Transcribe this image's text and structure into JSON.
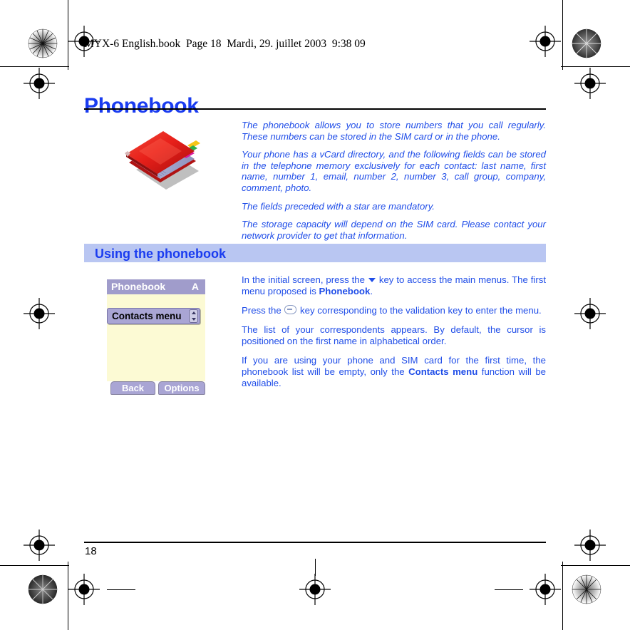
{
  "document": {
    "file_header": "MYX-6 English.book  Page 18  Mardi, 29. juillet 2003  9:38 09",
    "title": "Phonebook",
    "page_number": "18"
  },
  "colors": {
    "heading_blue": "#1a3cf0",
    "body_blue": "#1f4de8",
    "band_background": "#b9c6f2",
    "phone_titlebar": "#a09ccb",
    "phone_screen": "#fcfad4",
    "phone_row": "#a9a5d4"
  },
  "intro": {
    "paragraphs": [
      "The phonebook allows you to store numbers that you call regularly. These numbers can be stored in the SIM card or in the phone.",
      "Your phone has a vCard directory, and the following fields can be stored in the telephone memory exclusively for each contact: last name, first name, number 1, email, number 2, number 3, call group, company, comment, photo.",
      "The fields preceded with a star are mandatory.",
      "The storage capacity will depend on the SIM card. Please contact your network provider to get that information."
    ],
    "image_alt": "address-book-illustration"
  },
  "section": {
    "heading": "Using the phonebook"
  },
  "phone_mock": {
    "titlebar": {
      "label": "Phonebook",
      "indicator": "A"
    },
    "menu_item": "Contacts menu",
    "softkeys": {
      "left": "Back",
      "right": "Options"
    }
  },
  "body": {
    "p1_before_icon": "In the initial screen, press the ",
    "p1_after_icon": " key to access the main menus. The first menu proposed is ",
    "p1_bold": "Phonebook",
    "p1_end": ".",
    "p2_before_icon": "Press the ",
    "p2_after_icon": " key corresponding to the validation key to enter the menu.",
    "p3": "The list of your correspondents appears. By default, the cursor is positioned on the first name in alphabetical order.",
    "p4_start": "If you are using your phone and SIM card for the first time, the phonebook list will be empty, only the ",
    "p4_bold": "Contacts menu",
    "p4_end": " function will be available."
  }
}
